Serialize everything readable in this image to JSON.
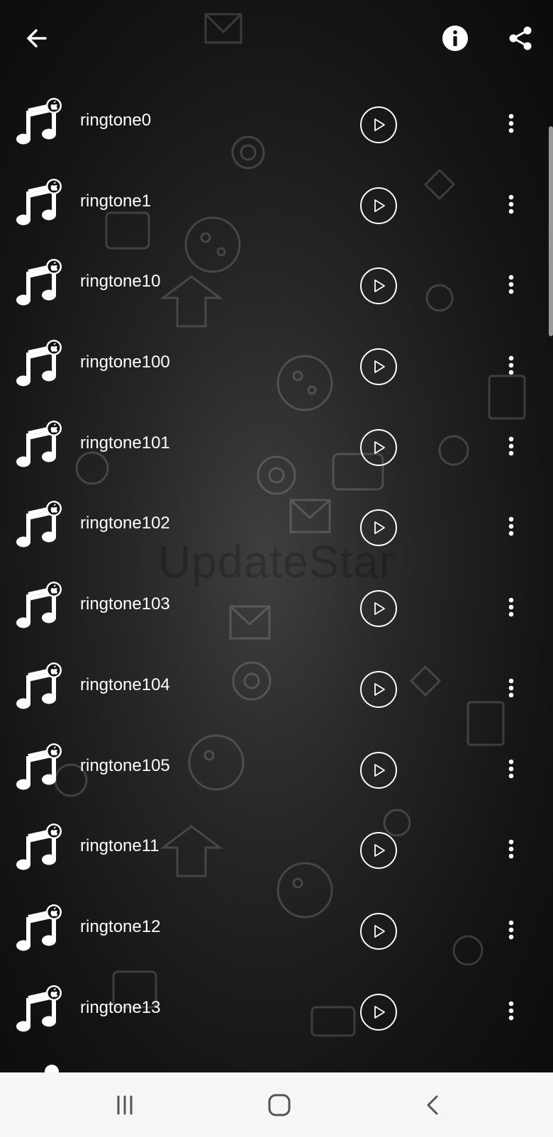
{
  "topbar": {
    "back_icon": "arrow-left-icon",
    "info_icon": "info-icon",
    "share_icon": "share-icon"
  },
  "watermark": "UpdateStar",
  "ringtones": [
    {
      "name": "ringtone0"
    },
    {
      "name": "ringtone1"
    },
    {
      "name": "ringtone10"
    },
    {
      "name": "ringtone100"
    },
    {
      "name": "ringtone101"
    },
    {
      "name": "ringtone102"
    },
    {
      "name": "ringtone103"
    },
    {
      "name": "ringtone104"
    },
    {
      "name": "ringtone105"
    },
    {
      "name": "ringtone11"
    },
    {
      "name": "ringtone12"
    },
    {
      "name": "ringtone13"
    }
  ],
  "navbar": {
    "recents_icon": "recents-icon",
    "home_icon": "home-icon",
    "back_icon": "nav-back-icon"
  },
  "colors": {
    "background": "#1a1a1a",
    "text": "#ffffff",
    "navbar": "#f6f6f6"
  }
}
